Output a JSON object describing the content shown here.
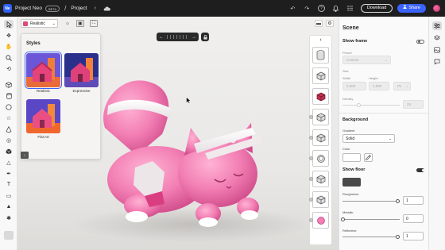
{
  "header": {
    "logo_text": "Ne",
    "app_name": "Project Neo",
    "beta_label": "BETA",
    "separator": "/",
    "project_name": "Project",
    "download_label": "Download",
    "share_label": "Share"
  },
  "viewport": {
    "style_select_value": "Realistic"
  },
  "styles_panel": {
    "title": "Styles",
    "items": [
      {
        "label": "Realistic",
        "selected": true
      },
      {
        "label": "Expressive",
        "selected": false
      },
      {
        "label": "Flat Art",
        "selected": false
      }
    ]
  },
  "scene_panel": {
    "title": "Scene",
    "show_frame_label": "Show frame",
    "show_frame_on": false,
    "preset_label": "Preset",
    "preset_value": "Custom",
    "size_label": "Size",
    "width_label": "Width",
    "width_value": "2,000",
    "height_label": "Height",
    "height_value": "2,000",
    "unit_value": "Px",
    "density_label": "Density",
    "density_value": "2X",
    "background_title": "Background",
    "gradient_label": "Gradient",
    "gradient_value": "Solid",
    "color_label": "Color",
    "show_floor_label": "Show floor",
    "show_floor_on": true,
    "floor_color": "#4a4a4a",
    "roughness_label": "Roughness",
    "roughness_value": "1",
    "metallic_label": "Metallic",
    "metallic_value": "0",
    "reflective_label": "Reflective",
    "reflective_value": "1"
  },
  "colors": {
    "accent": "#3b63fb",
    "topbar": "#1e1e1e",
    "cat_pink": "#f27eb3"
  }
}
